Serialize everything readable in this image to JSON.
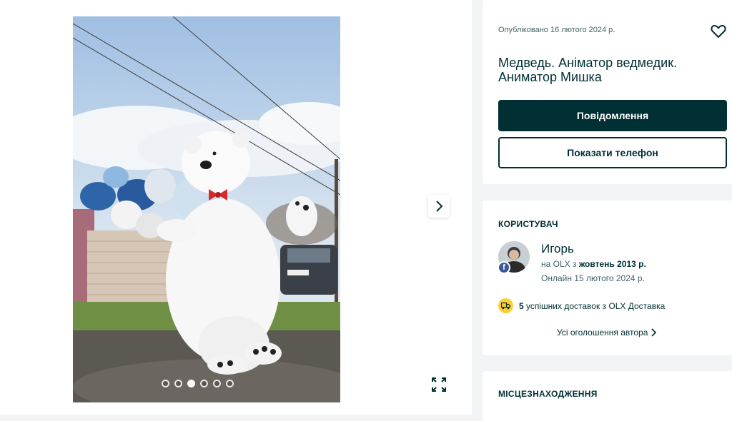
{
  "gallery": {
    "image_alt": "Polar bear mascot costume with balloons",
    "dot_count": 6,
    "active_dot": 3,
    "next_icon": "chevron-right-icon",
    "fullscreen_icon": "expand-icon"
  },
  "listing": {
    "published": "Опубліковано 16 лютого 2024 р.",
    "title": "Медведь. Аніматор ведмедик. Аниматор Мишка",
    "message_button": "Повідомлення",
    "phone_button": "Показати телефон"
  },
  "user": {
    "heading": "КОРИСТУВАЧ",
    "name": "Игорь",
    "since_prefix": "на OLX з ",
    "since_value": "жовтень 2013 р.",
    "online": "Онлайн 15 лютого 2024 р.",
    "delivery_count": "5",
    "delivery_text": " успішних доставок з OLX Доставка",
    "all_ads": "Усі оголошення автора",
    "badge": "f"
  },
  "location": {
    "heading": "МІСЦЕЗНАХОДЖЕННЯ"
  },
  "colors": {
    "primary": "#002f34",
    "delivery_badge": "#ffce32",
    "facebook": "#3b5998"
  }
}
